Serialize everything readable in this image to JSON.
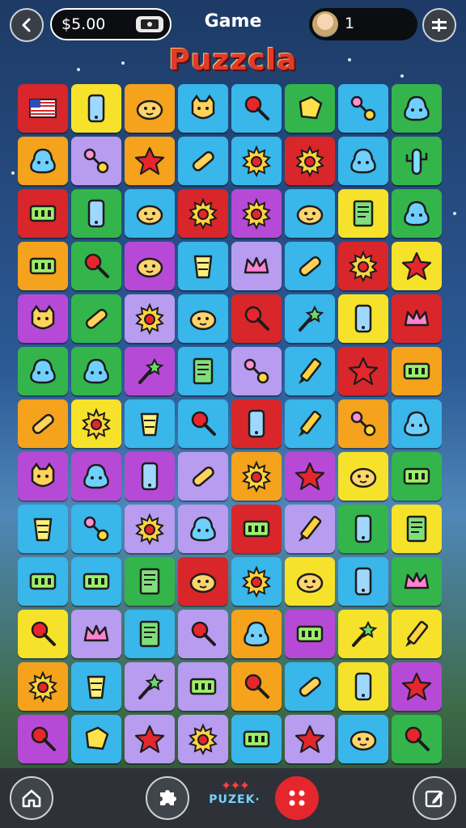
{
  "header": {
    "balance": "$5.00",
    "title": "Game",
    "player_count": "1",
    "icons": {
      "back": "back-chevron-icon",
      "cash": "cash-icon",
      "avatar": "player-avatar",
      "menu": "menu-icon"
    }
  },
  "logo": {
    "text": "Puzzcla"
  },
  "board": {
    "columns": 8,
    "rows": 13,
    "tiles": [
      [
        "#d8262a",
        "flag"
      ],
      [
        "#f6e22a",
        "phone"
      ],
      [
        "#f5a21c",
        "face"
      ],
      [
        "#39b6ea",
        "cat"
      ],
      [
        "#39b6ea",
        "pin"
      ],
      [
        "#33b54b",
        "box"
      ],
      [
        "#39b6ea",
        "dumbbell"
      ],
      [
        "#33b54b",
        "blob"
      ],
      [
        "#f5a21c",
        "blob"
      ],
      [
        "#b79cf0",
        "dumbbell"
      ],
      [
        "#f5a21c",
        "star"
      ],
      [
        "#39b6ea",
        "bandage"
      ],
      [
        "#39b6ea",
        "sun"
      ],
      [
        "#d8262a",
        "sun"
      ],
      [
        "#39b6ea",
        "blob"
      ],
      [
        "#33b54b",
        "cactus"
      ],
      [
        "#d8262a",
        "chip"
      ],
      [
        "#33b54b",
        "phone"
      ],
      [
        "#39b6ea",
        "face"
      ],
      [
        "#d8262a",
        "sun"
      ],
      [
        "#b64ad6",
        "sun"
      ],
      [
        "#39b6ea",
        "face"
      ],
      [
        "#f6e22a",
        "book"
      ],
      [
        "#33b54b",
        "blob"
      ],
      [
        "#f5a21c",
        "chip"
      ],
      [
        "#33b54b",
        "pin"
      ],
      [
        "#b64ad6",
        "face"
      ],
      [
        "#39b6ea",
        "cup"
      ],
      [
        "#b79cf0",
        "crown"
      ],
      [
        "#39b6ea",
        "bandage"
      ],
      [
        "#d8262a",
        "sun"
      ],
      [
        "#f6e22a",
        "star"
      ],
      [
        "#b64ad6",
        "cat"
      ],
      [
        "#33b54b",
        "bandage"
      ],
      [
        "#b79cf0",
        "sun"
      ],
      [
        "#39b6ea",
        "face"
      ],
      [
        "#d8262a",
        "pin"
      ],
      [
        "#39b6ea",
        "wand"
      ],
      [
        "#f6e22a",
        "phone"
      ],
      [
        "#d8262a",
        "crown"
      ],
      [
        "#33b54b",
        "blob"
      ],
      [
        "#33b54b",
        "blob"
      ],
      [
        "#b64ad6",
        "wand"
      ],
      [
        "#39b6ea",
        "book"
      ],
      [
        "#b79cf0",
        "dumbbell"
      ],
      [
        "#39b6ea",
        "pen"
      ],
      [
        "#d8262a",
        "star"
      ],
      [
        "#f5a21c",
        "chip"
      ],
      [
        "#f5a21c",
        "bandage"
      ],
      [
        "#f6e22a",
        "sun"
      ],
      [
        "#39b6ea",
        "cup"
      ],
      [
        "#39b6ea",
        "pin"
      ],
      [
        "#d8262a",
        "phone"
      ],
      [
        "#39b6ea",
        "pen"
      ],
      [
        "#f5a21c",
        "dumbbell"
      ],
      [
        "#39b6ea",
        "blob"
      ],
      [
        "#b64ad6",
        "cat"
      ],
      [
        "#b64ad6",
        "blob"
      ],
      [
        "#b64ad6",
        "phone"
      ],
      [
        "#b79cf0",
        "bandage"
      ],
      [
        "#f5a21c",
        "sun"
      ],
      [
        "#b64ad6",
        "star"
      ],
      [
        "#f6e22a",
        "face"
      ],
      [
        "#33b54b",
        "chip"
      ],
      [
        "#39b6ea",
        "cup"
      ],
      [
        "#39b6ea",
        "dumbbell"
      ],
      [
        "#b79cf0",
        "sun"
      ],
      [
        "#b79cf0",
        "blob"
      ],
      [
        "#d8262a",
        "chip"
      ],
      [
        "#b79cf0",
        "pen"
      ],
      [
        "#33b54b",
        "phone"
      ],
      [
        "#f6e22a",
        "book"
      ],
      [
        "#39b6ea",
        "chip"
      ],
      [
        "#39b6ea",
        "chip"
      ],
      [
        "#33b54b",
        "book"
      ],
      [
        "#d8262a",
        "face"
      ],
      [
        "#39b6ea",
        "sun"
      ],
      [
        "#f6e22a",
        "face"
      ],
      [
        "#39b6ea",
        "phone"
      ],
      [
        "#33b54b",
        "crown"
      ],
      [
        "#f6e22a",
        "pin"
      ],
      [
        "#b79cf0",
        "crown"
      ],
      [
        "#39b6ea",
        "book"
      ],
      [
        "#b79cf0",
        "pin"
      ],
      [
        "#f5a21c",
        "blob"
      ],
      [
        "#b64ad6",
        "chip"
      ],
      [
        "#f6e22a",
        "wand"
      ],
      [
        "#f6e22a",
        "pen"
      ],
      [
        "#f5a21c",
        "sun"
      ],
      [
        "#39b6ea",
        "cup"
      ],
      [
        "#b79cf0",
        "wand"
      ],
      [
        "#b79cf0",
        "chip"
      ],
      [
        "#f5a21c",
        "pin"
      ],
      [
        "#39b6ea",
        "bandage"
      ],
      [
        "#f6e22a",
        "phone"
      ],
      [
        "#b64ad6",
        "star"
      ],
      [
        "#b64ad6",
        "pin"
      ],
      [
        "#39b6ea",
        "box"
      ],
      [
        "#b79cf0",
        "star"
      ],
      [
        "#b79cf0",
        "sun"
      ],
      [
        "#39b6ea",
        "chip"
      ],
      [
        "#b79cf0",
        "star"
      ],
      [
        "#39b6ea",
        "face"
      ],
      [
        "#33b54b",
        "pin"
      ]
    ]
  },
  "bottom_bar": {
    "brand": "PUZEK·",
    "icons": {
      "home": "home-icon",
      "puzzle": "puzzle-piece-icon",
      "dice": "dice-icon",
      "edit": "edit-icon"
    }
  }
}
